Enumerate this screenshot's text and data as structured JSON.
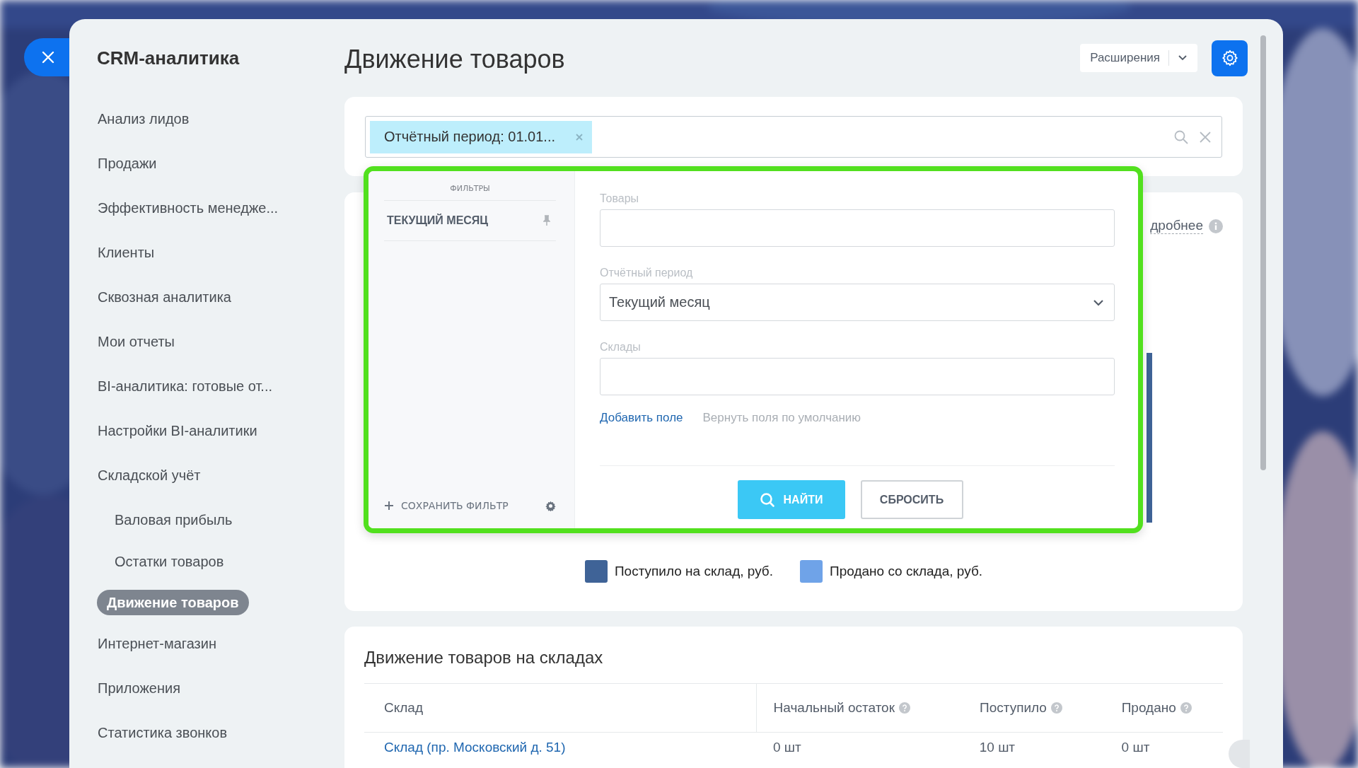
{
  "sidebar": {
    "title": "CRM-аналитика",
    "items": [
      {
        "label": "Анализ лидов",
        "selected": false
      },
      {
        "label": "Продажи",
        "selected": false
      },
      {
        "label": "Эффективность менедже...",
        "selected": false
      },
      {
        "label": "Клиенты",
        "selected": false
      },
      {
        "label": "Сквозная аналитика",
        "selected": false
      },
      {
        "label": "Мои отчеты",
        "selected": false
      },
      {
        "label": "BI-аналитика: готовые от...",
        "selected": false
      },
      {
        "label": "Настройки BI-аналитики",
        "selected": false
      },
      {
        "label": "Складской учёт",
        "selected": false,
        "children": [
          {
            "label": "Валовая прибыль",
            "selected": false
          },
          {
            "label": "Остатки товаров",
            "selected": false
          },
          {
            "label": "Движение товаров",
            "selected": true
          }
        ]
      },
      {
        "label": "Интернет-магазин",
        "selected": false
      },
      {
        "label": "Приложения",
        "selected": false
      },
      {
        "label": "Статистика звонков",
        "selected": false
      }
    ]
  },
  "header": {
    "title": "Движение товаров",
    "extensions_button": "Расширения"
  },
  "filter": {
    "chip": "Отчётный период: 01.01...",
    "popup": {
      "heading": "ФИЛЬТРЫ",
      "presets": [
        {
          "label": "ТЕКУЩИЙ МЕСЯЦ"
        }
      ],
      "save_filter": "СОХРАНИТЬ ФИЛЬТР",
      "fields": [
        {
          "kind": "input",
          "label": "Товары"
        },
        {
          "kind": "select",
          "label": "Отчётный период",
          "value": "Текущий месяц"
        },
        {
          "kind": "input",
          "label": "Склады"
        }
      ],
      "add_field": "Добавить поле",
      "restore_fields": "Вернуть поля по умолчанию",
      "buttons": [
        {
          "kind": "primary",
          "label": "НАЙТИ"
        },
        {
          "kind": "secondary",
          "label": "СБРОСИТЬ"
        }
      ]
    }
  },
  "chart_card": {
    "more_link": "дробнее",
    "legend": [
      {
        "label": "Поступило на склад, руб.",
        "color": "#3f6397"
      },
      {
        "label": "Продано со склада, руб.",
        "color": "#6fa3e8"
      }
    ]
  },
  "table": {
    "title": "Движение товаров на складах",
    "columns": [
      {
        "label": "Склад",
        "help": false
      },
      {
        "label": "Начальный остаток",
        "help": true
      },
      {
        "label": "Поступило",
        "help": true
      },
      {
        "label": "Продано",
        "help": true
      }
    ],
    "rows": [
      {
        "cells": [
          "Склад (пр. Московский д. 51)",
          "0 шт",
          "10 шт",
          "0 шт"
        ]
      }
    ]
  }
}
